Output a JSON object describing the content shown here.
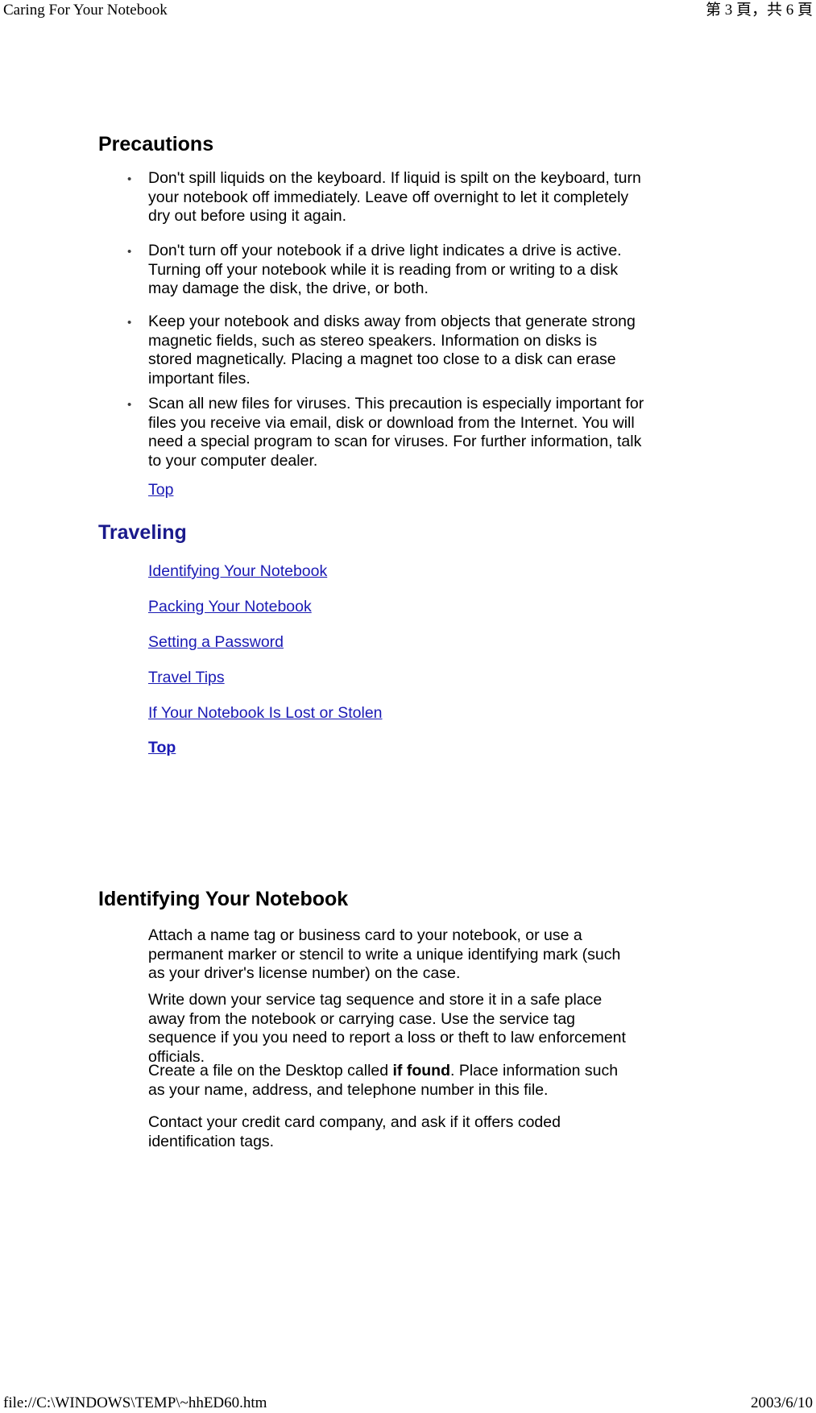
{
  "page": {
    "header": {
      "title": "Caring For Your Notebook",
      "pagination": "第 3 頁，共 6 頁"
    },
    "footer": {
      "file_path": "file://C:\\WINDOWS\\TEMP\\~hhED60.htm",
      "date": "2003/6/10"
    }
  },
  "colors": {
    "link": "#1a1ab4",
    "heading_navy": "#1a1a8c",
    "text": "#000000",
    "background": "#ffffff"
  },
  "sections": {
    "precautions": {
      "heading": "Precautions",
      "bullet_glyph": "•",
      "bullets": [
        "Don't spill liquids on the keyboard. If liquid is spilt on the keyboard, turn your notebook off immediately. Leave off overnight to let it completely dry out before using it again.",
        "Don't turn off your notebook if a drive light indicates a drive is active. Turning off your notebook while it is reading from or writing to a disk may damage the disk, the drive, or both.",
        "Keep your notebook and disks away from objects that generate strong magnetic fields, such as stereo speakers. Information on disks is stored magnetically. Placing a magnet too close to a disk can erase important files.",
        "Scan all new files for viruses. This precaution is especially important for files you receive via email, disk or download from the Internet. You will need a special program to scan for viruses. For further information, talk to your computer dealer."
      ],
      "top_link": "Top"
    },
    "traveling": {
      "heading": "Traveling",
      "links": [
        "Identifying Your Notebook",
        "Packing Your Notebook",
        "Setting a Password",
        "Travel Tips",
        "If Your Notebook Is Lost or Stolen"
      ],
      "top_link": "Top"
    },
    "identifying": {
      "heading": "Identifying Your Notebook",
      "paragraphs": [
        {
          "before": "Attach a name tag or business card to your notebook, or use a permanent marker or stencil to write a unique identifying mark (such as your driver's license number) on the case.",
          "bold": "",
          "after": ""
        },
        {
          "before": "Write down your service tag sequence and store it in a safe place away from the notebook or carrying case. Use the service tag sequence if you you need to report a loss or theft to law enforcement officials.",
          "bold": "",
          "after": ""
        },
        {
          "before": "Create a file on the Desktop called ",
          "bold": "if found",
          "after": ". Place information such as your name, address, and telephone number in this file."
        },
        {
          "before": "Contact your credit card company, and ask if it offers coded identification tags.",
          "bold": "",
          "after": ""
        }
      ]
    }
  }
}
